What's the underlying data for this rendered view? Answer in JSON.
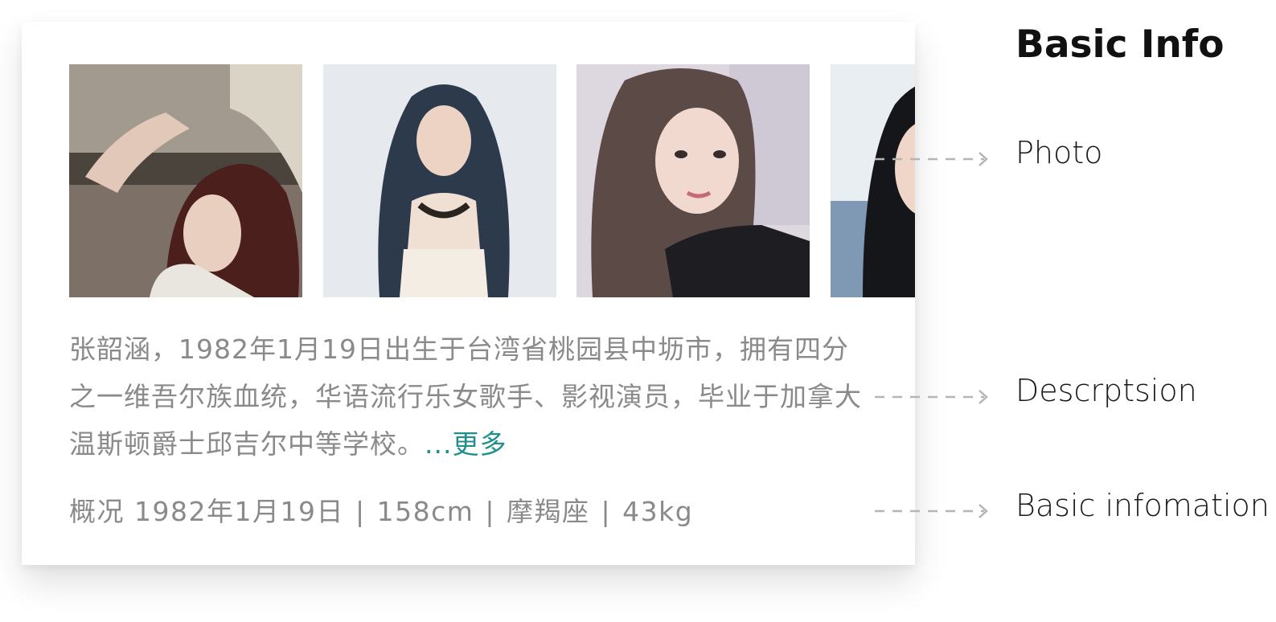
{
  "card": {
    "photos": [
      {
        "icon": "photo-portrait-car"
      },
      {
        "icon": "photo-portrait-necklace"
      },
      {
        "icon": "photo-portrait-selfie"
      },
      {
        "icon": "photo-portrait-cropped"
      }
    ],
    "description": "张韶涵，1982年1月19日出生于台湾省桃园县中坜市，拥有四分之一维吾尔族血统，华语流行乐女歌手、影视演员，毕业于加拿大温斯顿爵士邱吉尔中等学校。",
    "more_label": "...更多",
    "basic": {
      "prefix": "概况",
      "birthday": "1982年1月19日",
      "height": "158cm",
      "zodiac": "摩羯座",
      "weight": "43kg",
      "separator": "|"
    }
  },
  "annotations": {
    "title": "Basic Info",
    "photo_label": "Photo",
    "description_label": "Descrptsion",
    "basic_label": "Basic infomation"
  },
  "colors": {
    "text_gray": "#8a8a8a",
    "accent_teal": "#1f8f8c",
    "arrow_gray": "#b5b5b5"
  }
}
